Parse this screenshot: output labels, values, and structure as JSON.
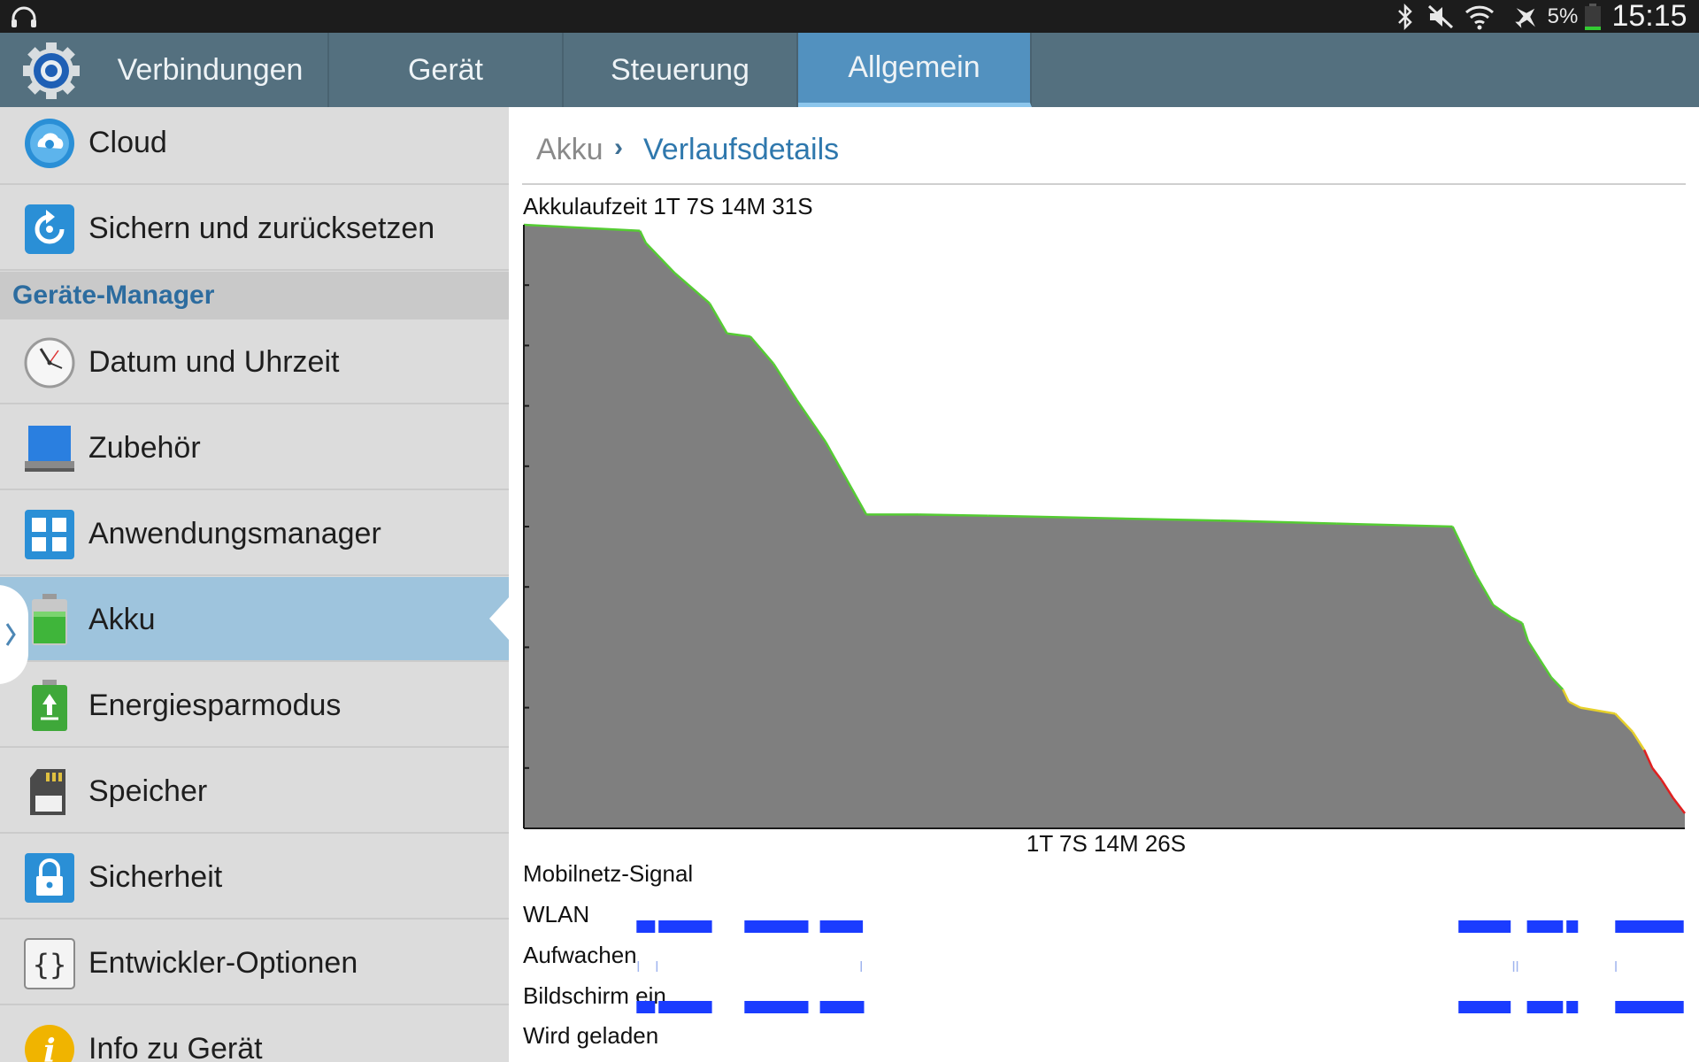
{
  "status_bar": {
    "left_icon": "headphones-icon",
    "icons": [
      "bluetooth-icon",
      "mute-icon",
      "wifi-icon",
      "airplane-icon"
    ],
    "battery_percent": "5%",
    "battery_icon": "battery-icon",
    "time": "15:15"
  },
  "tabs": [
    {
      "label": "Verbindungen",
      "active": false
    },
    {
      "label": "Gerät",
      "active": false
    },
    {
      "label": "Steuerung",
      "active": false
    },
    {
      "label": "Allgemein",
      "active": true
    }
  ],
  "sidebar": {
    "items": [
      {
        "label": "Cloud",
        "icon": "cloud-icon"
      },
      {
        "label": "Sichern und zurücksetzen",
        "icon": "backup-icon"
      },
      {
        "section": "Geräte-Manager"
      },
      {
        "label": "Datum und Uhrzeit",
        "icon": "clock-icon"
      },
      {
        "label": "Zubehör",
        "icon": "accessory-icon"
      },
      {
        "label": "Anwendungsmanager",
        "icon": "apps-icon"
      },
      {
        "label": "Akku",
        "icon": "battery-icon",
        "selected": true
      },
      {
        "label": "Energiesparmodus",
        "icon": "power-saving-icon"
      },
      {
        "label": "Speicher",
        "icon": "storage-icon"
      },
      {
        "label": "Sicherheit",
        "icon": "lock-icon"
      },
      {
        "label": "Entwickler-Optionen",
        "icon": "developer-icon"
      },
      {
        "label": "Info zu Gerät",
        "icon": "info-icon"
      }
    ]
  },
  "breadcrumb": {
    "root": "Akku",
    "separator": "›",
    "current": "Verlaufsdetails"
  },
  "battery_history": {
    "runtime_label": "Akkulaufzeit 1T 7S 14M 31S",
    "time_label": "1T 7S 14M 26S"
  },
  "chart_data": {
    "type": "area",
    "ylabel": "",
    "xlabel": "",
    "ylim": [
      0,
      100
    ],
    "y_ticks": 10,
    "fill_color": "#7f7f7f",
    "line_colors": {
      "high": "#55cc33",
      "medium": "#e6d02a",
      "low": "#e02020"
    },
    "x": [
      0,
      0.1,
      0.105,
      0.13,
      0.16,
      0.175,
      0.195,
      0.215,
      0.235,
      0.26,
      0.295,
      0.34,
      0.4,
      0.5,
      0.6,
      0.7,
      0.8,
      0.81,
      0.82,
      0.835,
      0.85,
      0.86,
      0.865,
      0.875,
      0.885,
      0.895,
      0.9,
      0.91,
      0.94,
      0.955,
      0.965,
      0.972,
      0.98,
      0.99,
      1.0
    ],
    "values": [
      100,
      99,
      97,
      92,
      87,
      82,
      81.5,
      77,
      71,
      64,
      52,
      52,
      51.8,
      51.4,
      51,
      50.5,
      50,
      46,
      42,
      37,
      35,
      34,
      31,
      28,
      25,
      23,
      21,
      20,
      19,
      16,
      13,
      10,
      8,
      5,
      2.5
    ]
  },
  "tracks": {
    "labels": [
      "Mobilnetz-Signal",
      "WLAN",
      "Aufwachen",
      "Bildschirm ein",
      "Wird geladen"
    ],
    "color": "#1a3cff",
    "wifi": [
      [
        0.097,
        0.113
      ],
      [
        0.116,
        0.162
      ],
      [
        0.19,
        0.245
      ],
      [
        0.255,
        0.292
      ],
      [
        0.805,
        0.85
      ],
      [
        0.864,
        0.895
      ],
      [
        0.898,
        0.908
      ],
      [
        0.94,
        0.999
      ]
    ],
    "wake_ticks": [
      0.098,
      0.114,
      0.29,
      0.852,
      0.855,
      0.94
    ],
    "screen": [
      [
        0.097,
        0.113
      ],
      [
        0.116,
        0.162
      ],
      [
        0.19,
        0.245
      ],
      [
        0.255,
        0.293
      ],
      [
        0.805,
        0.85
      ],
      [
        0.864,
        0.895
      ],
      [
        0.898,
        0.908
      ],
      [
        0.94,
        0.999
      ]
    ]
  }
}
